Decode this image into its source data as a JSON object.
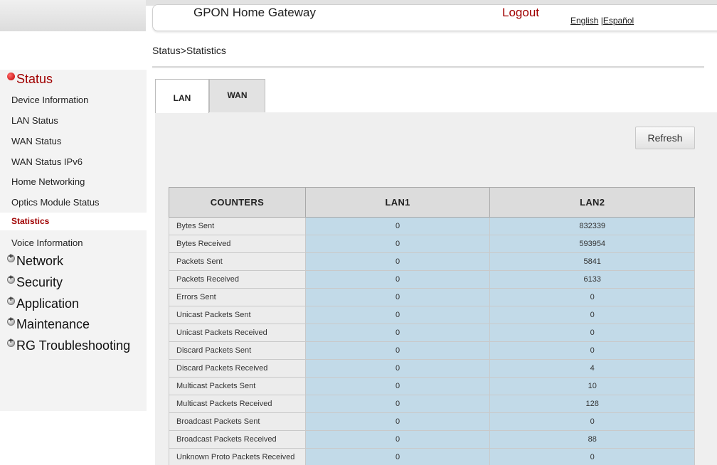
{
  "header": {
    "title": "GPON Home Gateway",
    "logout": "Logout",
    "lang_english": "English",
    "lang_separator": " |",
    "lang_spanish": "Español"
  },
  "breadcrumb": "Status>Statistics",
  "sidebar": {
    "status_label": "Status",
    "items": [
      "Device Information",
      "LAN Status",
      "WAN Status",
      "WAN Status IPv6",
      "Home Networking",
      "Optics Module Status",
      "Statistics",
      "Voice Information"
    ],
    "active_item": "Statistics",
    "sections": [
      "Network",
      "Security",
      "Application",
      "Maintenance",
      "RG Troubleshooting"
    ]
  },
  "tabs": [
    {
      "label": "LAN",
      "active": true
    },
    {
      "label": "WAN",
      "active": false
    }
  ],
  "refresh_label": "Refresh",
  "table": {
    "headers": [
      "COUNTERS",
      "LAN1",
      "LAN2"
    ],
    "rows": [
      [
        "Bytes Sent",
        "0",
        "832339"
      ],
      [
        "Bytes Received",
        "0",
        "593954"
      ],
      [
        "Packets Sent",
        "0",
        "5841"
      ],
      [
        "Packets Received",
        "0",
        "6133"
      ],
      [
        "Errors Sent",
        "0",
        "0"
      ],
      [
        "Unicast Packets Sent",
        "0",
        "0"
      ],
      [
        "Unicast Packets Received",
        "0",
        "0"
      ],
      [
        "Discard Packets Sent",
        "0",
        "0"
      ],
      [
        "Discard Packets Received",
        "0",
        "4"
      ],
      [
        "Multicast Packets Sent",
        "0",
        "10"
      ],
      [
        "Multicast Packets Received",
        "0",
        "128"
      ],
      [
        "Broadcast Packets Sent",
        "0",
        "0"
      ],
      [
        "Broadcast Packets Received",
        "0",
        "88"
      ],
      [
        "Unknown Proto Packets Received",
        "0",
        "0"
      ]
    ]
  },
  "colors": {
    "accent_red": "#a00000",
    "value_cell": "#c2dae8",
    "header_cell": "#dcdcdc",
    "panel_bg": "#efefef"
  },
  "icons": {
    "expanded_section": "minus-bullet-icon",
    "collapsed_section": "plus-bullet-icon"
  }
}
